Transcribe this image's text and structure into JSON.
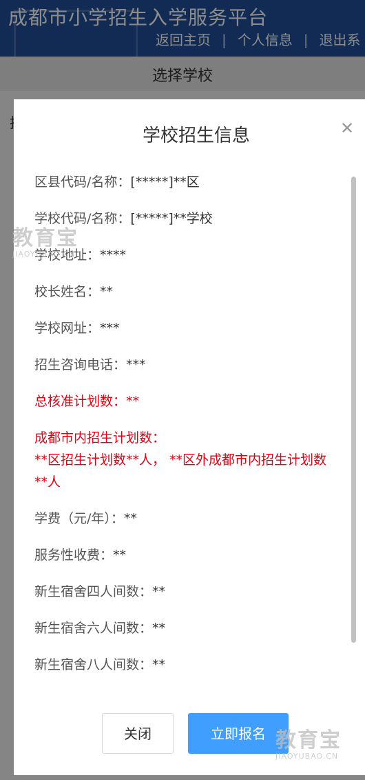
{
  "header": {
    "site_title": "成都市小学招生入学服务平台",
    "nav": [
      "返回主页",
      "个人信息",
      "退出系"
    ],
    "nav_separator": "|"
  },
  "subbar": {
    "title": "选择学校"
  },
  "page_body": {
    "fragment": "拄"
  },
  "modal": {
    "title": "学校招生信息",
    "close_icon": "close-icon",
    "rows": {
      "district": {
        "label": "区县代码/名称：",
        "value": "[*****]**区"
      },
      "school": {
        "label": "学校代码/名称：",
        "value": "[*****]**学校"
      },
      "address": {
        "label": "学校地址：",
        "value": "****"
      },
      "principal": {
        "label": "校长姓名：",
        "value": "**"
      },
      "website": {
        "label": "学校网址：",
        "value": "***"
      },
      "phone": {
        "label": "招生咨询电话：",
        "value": "***"
      },
      "total_quota": {
        "label": "总核准计划数：",
        "value": "**"
      },
      "tuition": {
        "label": "学费（元/年）：",
        "value": "**"
      },
      "service_fee": {
        "label": "服务性收费：",
        "value": "**"
      },
      "dorm4": {
        "label": "新生宿舍四人间数：",
        "value": "**"
      },
      "dorm6": {
        "label": "新生宿舍六人间数：",
        "value": "**"
      },
      "dorm8": {
        "label": "新生宿舍八人间数：",
        "value": "**"
      }
    },
    "city_plan": {
      "label": "成都市内招生计划数：",
      "line1": "**区招生计划数**人， **区外成都市内招生计划数",
      "line2": "**人"
    },
    "buttons": {
      "close": "关闭",
      "apply": "立即报名"
    }
  },
  "watermark": {
    "cn": "教育宝",
    "en": "JIAOYUBAO.CN",
    "domain": "JIAOYUBAO.CN"
  },
  "colors": {
    "header_bg": "#1f4f9c",
    "highlight_red": "#e60012",
    "primary_button": "#409eff"
  }
}
